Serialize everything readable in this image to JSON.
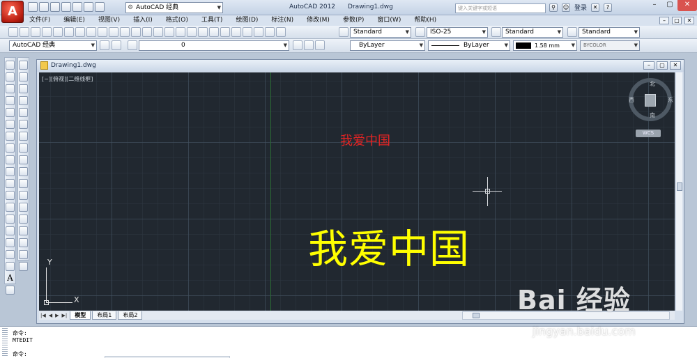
{
  "titlebar": {
    "workspace": "AutoCAD 经典",
    "app_title": "AutoCAD 2012",
    "doc_title": "Drawing1.dwg",
    "search_placeholder": "键入关键字或短语",
    "login": "登录"
  },
  "menu": [
    "文件(F)",
    "编辑(E)",
    "视图(V)",
    "插入(I)",
    "格式(O)",
    "工具(T)",
    "绘图(D)",
    "标注(N)",
    "修改(M)",
    "参数(P)",
    "窗口(W)",
    "帮助(H)"
  ],
  "styles": {
    "text_style": "Standard",
    "dim_style": "ISO-25",
    "table_style": "Standard",
    "multileader_style": "Standard"
  },
  "layers": {
    "workspace2": "AutoCAD 经典",
    "current_layer": "0",
    "color": "ByLayer",
    "linetype": "ByLayer",
    "lineweight": "1.58 mm",
    "plotstyle": "BYCOLOR"
  },
  "left_toolbar": {
    "text_tool": "A"
  },
  "drawing": {
    "tab_title": "Drawing1.dwg",
    "view_label": "[−][俯视][二维线框]",
    "red_text": "我爱中国",
    "yellow_text": "我爱中国",
    "ucs_x": "X",
    "ucs_y": "Y",
    "viewcube": {
      "north": "北",
      "south": "南",
      "east": "东",
      "west": "西",
      "wcs": "WCS"
    }
  },
  "tabs": [
    {
      "label": "模型",
      "active": true
    },
    {
      "label": "布局1",
      "active": false
    },
    {
      "label": "布局2",
      "active": false
    }
  ],
  "command": {
    "line1": "命令:",
    "line2": "MTEDIT",
    "line3": "命令:"
  },
  "watermark": {
    "logo": "Bai 经验",
    "url": "jingyan.baidu.com"
  }
}
